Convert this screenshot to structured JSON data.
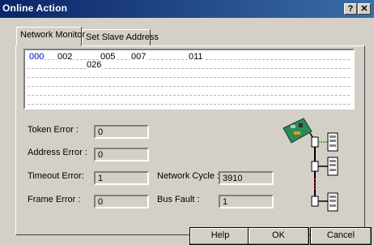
{
  "window": {
    "title": "Online Action",
    "help_btn": "?",
    "close_btn": "✕"
  },
  "tabs": [
    {
      "label": "Network Monitor",
      "active": true
    },
    {
      "label": "Set Slave Address",
      "active": false
    }
  ],
  "monitor": {
    "addresses": [
      {
        "text": "000",
        "color": "#0000c0"
      },
      {
        "text": "002",
        "color": "#000000"
      },
      {
        "text": "026",
        "color": "#000000"
      },
      {
        "text": "005",
        "color": "#000000"
      },
      {
        "text": "007",
        "color": "#000000"
      },
      {
        "text": "011",
        "color": "#000000"
      }
    ]
  },
  "fields": {
    "token_error": {
      "label": "Token Error :",
      "value": "0"
    },
    "address_error": {
      "label": "Address Error :",
      "value": "0"
    },
    "timeout_error": {
      "label": "Timeout Error:",
      "value": "1"
    },
    "frame_error": {
      "label": "Frame Error :",
      "value": "0"
    },
    "network_cycle": {
      "label": "Network Cycle :",
      "value": "3910"
    },
    "bus_fault": {
      "label": "Bus Fault :",
      "value": "1"
    }
  },
  "buttons": {
    "help": "Help",
    "ok": "OK",
    "cancel": "Cancel"
  },
  "icons": {
    "network": "network-diagram-icon"
  }
}
